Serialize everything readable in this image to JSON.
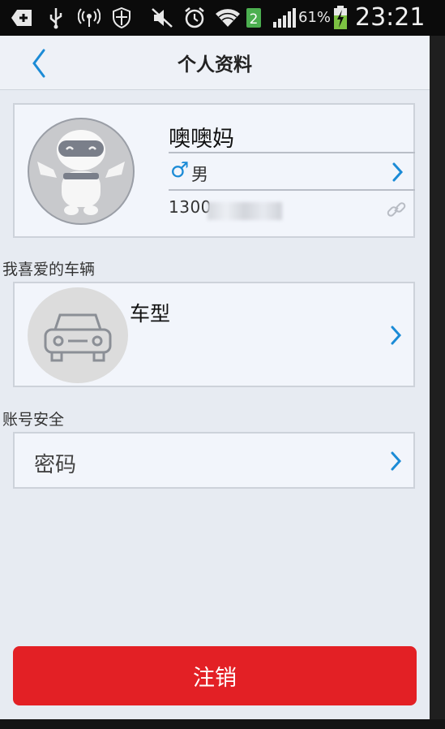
{
  "status_bar": {
    "battery_percent": "61%",
    "time": "23:21",
    "sim_badge": "2",
    "icons": [
      "add-icon",
      "usb-icon",
      "wireless-signal-icon",
      "shield-icon",
      "mute-icon",
      "alarm-icon",
      "wifi-icon",
      "sim-icon",
      "signal-icon",
      "battery-charging-icon"
    ]
  },
  "header": {
    "title": "个人资料",
    "back_icon": "chevron-left-icon"
  },
  "profile": {
    "name": "噢噢妈",
    "gender_symbol": "♂",
    "gender": "男",
    "phone_visible": "1300"
  },
  "favorite_vehicle": {
    "section_title": "我喜爱的车辆",
    "label": "车型"
  },
  "account_security": {
    "section_title": "账号安全",
    "password_label": "密码"
  },
  "logout": {
    "label": "注销"
  },
  "colors": {
    "accent": "#1b8bd6",
    "danger": "#e32025",
    "background": "#e7ebf2"
  }
}
